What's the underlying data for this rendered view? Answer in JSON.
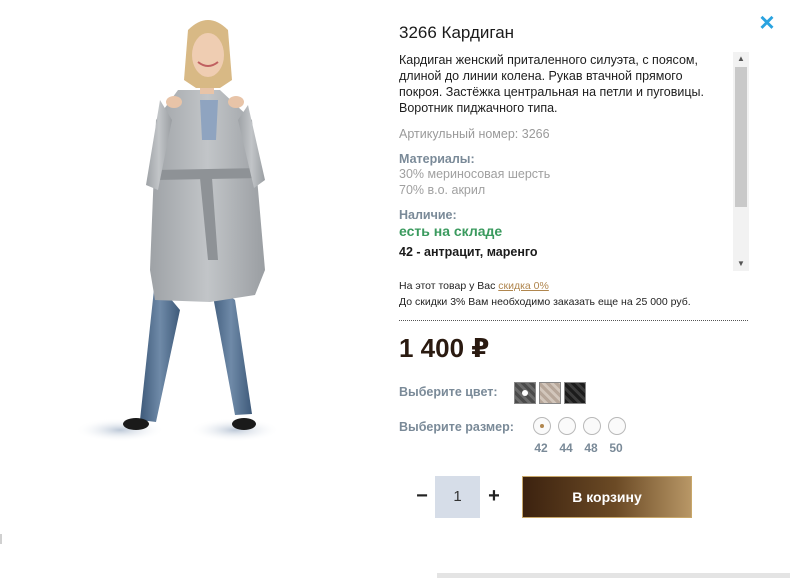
{
  "product": {
    "title": "3266 Кардиган",
    "description": "Кардиган женский приталенного силуэта, с поясом, длиной до линии колена. Рукав втачной прямого покроя. Застёжка центральная на петли и пуговицы. Воротник пиджачного типа.",
    "article": "Артикульный номер: 3266",
    "materials_label": "Материалы:",
    "materials": [
      "30% мериносовая шерсть",
      "70% в.о. акрил"
    ],
    "availability_label": "Наличие:",
    "availability_value": "есть на складе",
    "size_colors": "42 - антрацит, маренго"
  },
  "discount": {
    "prefix": "На этот товар у Вас",
    "link": "скидка 0%",
    "need": "До скидки 3% Вам необходимо заказать еще на 25 000 руб."
  },
  "price": "1 400 ₽",
  "color_picker": {
    "label": "Выберите цвет:",
    "swatches": [
      "антрацит",
      "бежевый меланж",
      "чёрный"
    ]
  },
  "size_picker": {
    "label": "Выберите размер:",
    "sizes": [
      "42",
      "44",
      "48",
      "50"
    ],
    "selected": "42"
  },
  "quantity": {
    "minus": "−",
    "value": "1",
    "plus": "+"
  },
  "cart_button": "В корзину",
  "close_icon": "×",
  "colors": {
    "accent_blue": "#2aa3e0",
    "in_stock_green": "#3a9a5e",
    "link_gold": "#b0864e",
    "button_brown": "#3c220f"
  }
}
